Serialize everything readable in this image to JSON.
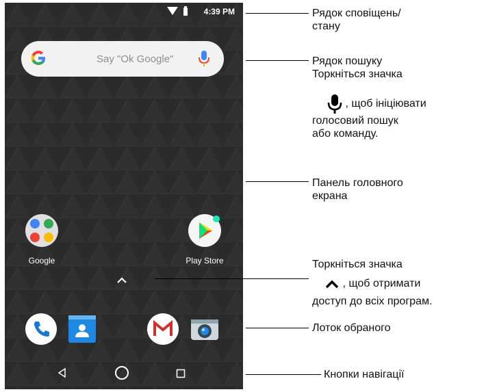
{
  "status_bar": {
    "time": "4:39 PM"
  },
  "search_bar": {
    "placeholder": "Say \"Ok Google\""
  },
  "home_apps": [
    {
      "label": "Google"
    },
    {
      "label": "Play Store"
    }
  ],
  "callouts": {
    "status": "Рядок сповіщень/",
    "status_2": "стану",
    "search_title": "Рядок пошуку",
    "search_tap": "Торкніться значка",
    "search_rest": ", щоб ініціювати",
    "search_rest_2": "голосовий пошук",
    "search_rest_3": "або команду.",
    "home_panel": "Панель головного",
    "home_panel_2": "екрана",
    "apps_tap": "Торкніться значка",
    "apps_rest": ", щоб отримати",
    "apps_rest_2": "доступ до всіх програм.",
    "favorites": "Лоток обраного",
    "nav_buttons": "Кнопки навігації"
  },
  "colors": {
    "wallpaper": "#2b2b2b",
    "search_bg": "#f2f2f2",
    "google_blue": "#4285f4",
    "google_red": "#ea4335",
    "google_yellow": "#fbbc05",
    "google_green": "#34a853",
    "contacts_blue": "#1e88e5",
    "phone_blue": "#1976d2"
  },
  "icons": [
    "wifi-icon",
    "battery-icon",
    "google-g-icon",
    "microphone-icon",
    "google-folder-icon",
    "play-store-icon",
    "chevron-up-icon",
    "phone-icon",
    "contacts-icon",
    "gmail-icon",
    "camera-icon",
    "back-icon",
    "home-icon",
    "recents-icon"
  ]
}
